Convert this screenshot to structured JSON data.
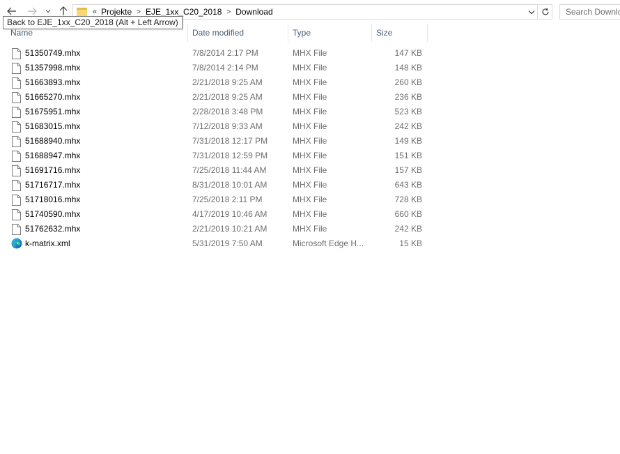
{
  "nav": {
    "back_icon": "arrow-left-icon",
    "forward_icon": "arrow-right-icon",
    "recent_icon": "chevron-down-icon",
    "up_icon": "arrow-up-icon"
  },
  "tooltip": "Back to EJE_1xx_C20_2018 (Alt + Left Arrow)",
  "address": {
    "overflow": "«",
    "crumbs": [
      "Projekte",
      "EJE_1xx_C20_2018",
      "Download"
    ],
    "separator": ">"
  },
  "search": {
    "placeholder": "Search Download"
  },
  "columns": {
    "name": "Name",
    "date": "Date modified",
    "type": "Type",
    "size": "Size"
  },
  "files": [
    {
      "name": "51350749.mhx",
      "date": "7/8/2014 2:17 PM",
      "type": "MHX File",
      "size": "147 KB",
      "icon": "file-icon"
    },
    {
      "name": "51357998.mhx",
      "date": "7/8/2014 2:14 PM",
      "type": "MHX File",
      "size": "148 KB",
      "icon": "file-icon"
    },
    {
      "name": "51663893.mhx",
      "date": "2/21/2018 9:25 AM",
      "type": "MHX File",
      "size": "260 KB",
      "icon": "file-icon"
    },
    {
      "name": "51665270.mhx",
      "date": "2/21/2018 9:25 AM",
      "type": "MHX File",
      "size": "236 KB",
      "icon": "file-icon"
    },
    {
      "name": "51675951.mhx",
      "date": "2/28/2018 3:48 PM",
      "type": "MHX File",
      "size": "523 KB",
      "icon": "file-icon"
    },
    {
      "name": "51683015.mhx",
      "date": "7/12/2018 9:33 AM",
      "type": "MHX File",
      "size": "242 KB",
      "icon": "file-icon"
    },
    {
      "name": "51688940.mhx",
      "date": "7/31/2018 12:17 PM",
      "type": "MHX File",
      "size": "149 KB",
      "icon": "file-icon"
    },
    {
      "name": "51688947.mhx",
      "date": "7/31/2018 12:59 PM",
      "type": "MHX File",
      "size": "151 KB",
      "icon": "file-icon"
    },
    {
      "name": "51691716.mhx",
      "date": "7/25/2018 11:44 AM",
      "type": "MHX File",
      "size": "157 KB",
      "icon": "file-icon"
    },
    {
      "name": "51716717.mhx",
      "date": "8/31/2018 10:01 AM",
      "type": "MHX File",
      "size": "643 KB",
      "icon": "file-icon"
    },
    {
      "name": "51718016.mhx",
      "date": "7/25/2018 2:11 PM",
      "type": "MHX File",
      "size": "728 KB",
      "icon": "file-icon"
    },
    {
      "name": "51740590.mhx",
      "date": "4/17/2019 10:46 AM",
      "type": "MHX File",
      "size": "660 KB",
      "icon": "file-icon"
    },
    {
      "name": "51762632.mhx",
      "date": "2/21/2019 10:21 AM",
      "type": "MHX File",
      "size": "242 KB",
      "icon": "file-icon"
    },
    {
      "name": "k-matrix.xml",
      "date": "5/31/2019 7:50 AM",
      "type": "Microsoft Edge H...",
      "size": "15 KB",
      "icon": "edge-icon"
    }
  ]
}
